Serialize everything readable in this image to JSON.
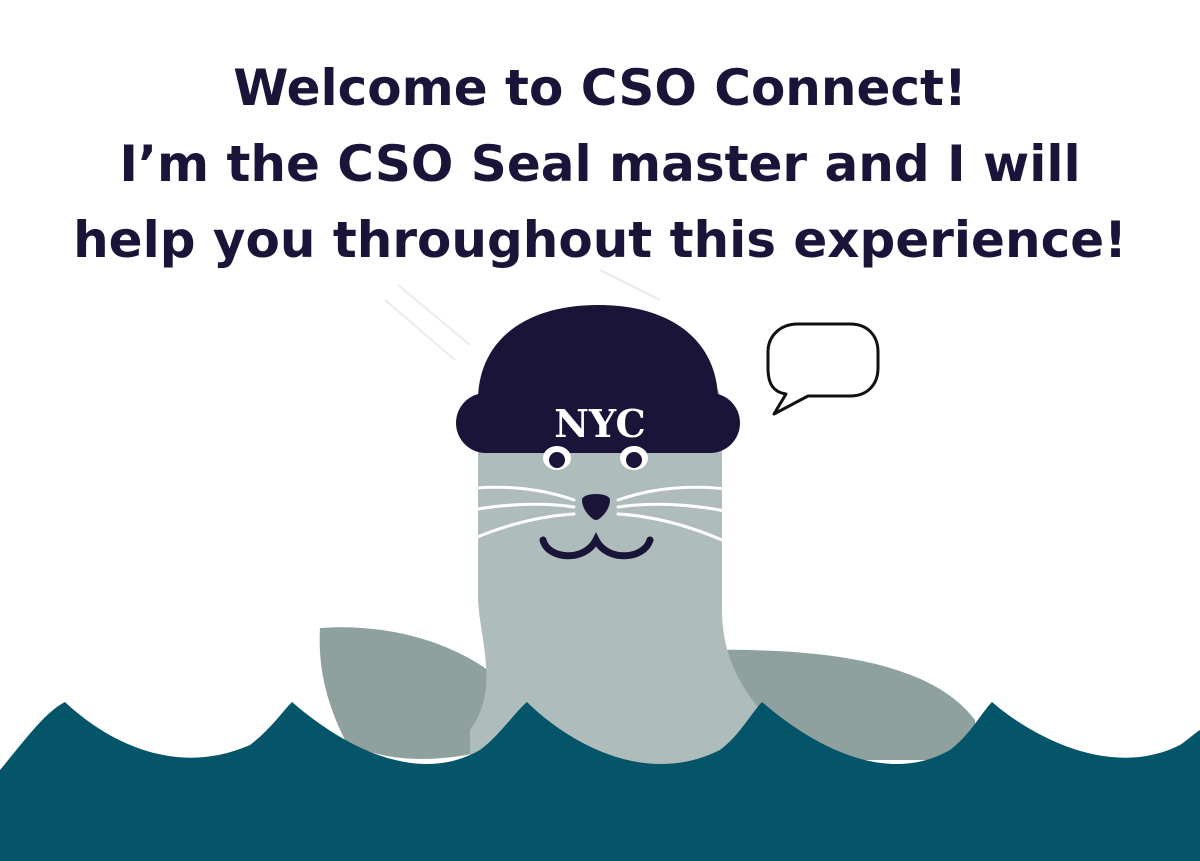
{
  "welcome": {
    "line1": "Welcome to CSO Connect!",
    "line2": "I’m the CSO Seal master and I will",
    "line3": "help you throughout this experience!"
  },
  "seal": {
    "hat_text": "NYC"
  },
  "colors": {
    "text": "#1a1438",
    "hat": "#1a1438",
    "seal_body": "#aebcbb",
    "seal_shadow": "#8fa19f",
    "water": "#04556a",
    "speech_bubble_stroke": "#111111"
  }
}
